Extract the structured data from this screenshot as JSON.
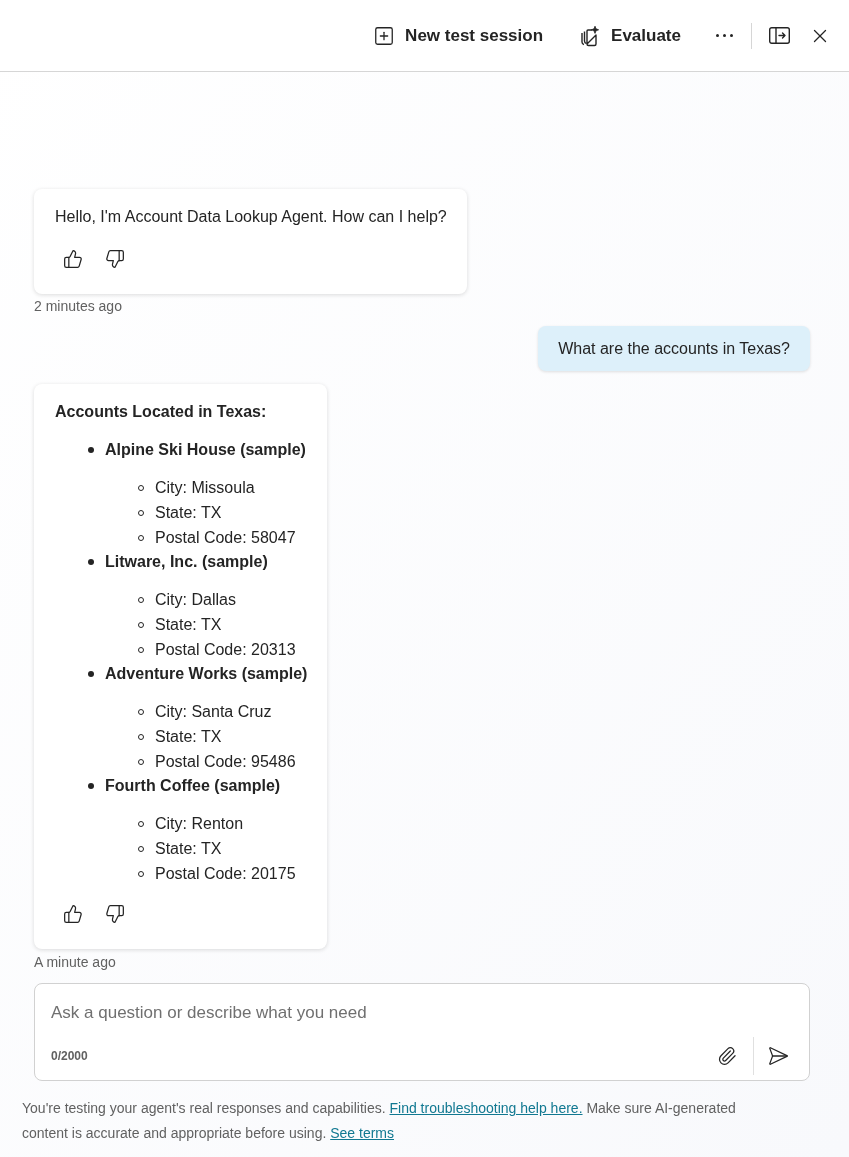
{
  "toolbar": {
    "buttons": [
      {
        "kind": "new_session",
        "label": "New test session"
      },
      {
        "kind": "evaluate",
        "label": "Evaluate"
      }
    ]
  },
  "messages": [
    {
      "kind": "bot",
      "text": "Hello, I'm Account Data Lookup Agent. How can I help?",
      "time": "2 minutes ago"
    },
    {
      "kind": "user",
      "text": "What are the accounts in Texas?"
    },
    {
      "kind": "bot",
      "heading": "Accounts Located in Texas:",
      "items": [
        {
          "text": "Alpine Ski House (sample)",
          "children": [
            {
              "text": "City: Missoula"
            },
            {
              "text": "State: TX"
            },
            {
              "text": "Postal Code: 58047"
            }
          ]
        },
        {
          "text": "Litware, Inc. (sample)",
          "children": [
            {
              "text": "City: Dallas"
            },
            {
              "text": "State: TX"
            },
            {
              "text": "Postal Code: 20313"
            }
          ]
        },
        {
          "text": "Adventure Works (sample)",
          "children": [
            {
              "text": "City: Santa Cruz"
            },
            {
              "text": "State: TX"
            },
            {
              "text": "Postal Code: 95486"
            }
          ]
        },
        {
          "text": "Fourth Coffee (sample)",
          "children": [
            {
              "text": "City: Renton"
            },
            {
              "text": "State: TX"
            },
            {
              "text": "Postal Code: 20175"
            }
          ]
        }
      ],
      "time": "A minute ago"
    }
  ],
  "composer": {
    "placeholder": "Ask a question or describe what you need",
    "counter": "0/2000"
  },
  "footer": {
    "parts": [
      {
        "kind": "text",
        "text": "You're testing your agent's real responses and capabilities. "
      },
      {
        "kind": "link",
        "text": "Find troubleshooting help here."
      },
      {
        "kind": "text",
        "text": " Make sure AI-generated content is accurate and appropriate before using. "
      },
      {
        "kind": "link",
        "text": "See terms"
      }
    ]
  }
}
